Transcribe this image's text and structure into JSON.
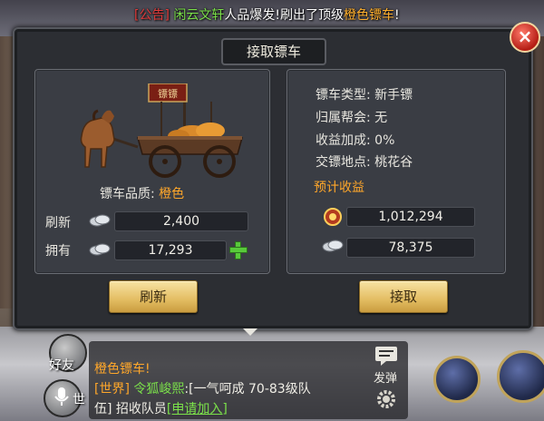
{
  "announcement": {
    "tag": "[公告]",
    "player": "闲云文轩",
    "text1": "人品爆发!刷出了顶级",
    "highlight": "橙色镖车",
    "text2": "!"
  },
  "dialog": {
    "title": "接取镖车",
    "close_symbol": "×"
  },
  "left_panel": {
    "cart_banner": "镖镖",
    "quality_label": "镖车品质:",
    "quality_value": "橙色",
    "refresh_label": "刷新",
    "refresh_cost": "2,400",
    "own_label": "拥有",
    "own_amount": "17,293",
    "refresh_button": "刷新"
  },
  "right_panel": {
    "type_label": "镖车类型:",
    "type_value": "新手镖",
    "guild_label": "归属帮会:",
    "guild_value": "无",
    "bonus_label": "收益加成:",
    "bonus_value": "0%",
    "place_label": "交镖地点:",
    "place_value": "桃花谷",
    "profit_title": "预计收益",
    "reward_exp": "1,012,294",
    "reward_silver": "78,375",
    "accept_button": "接取"
  },
  "chat": {
    "line1": "橙色镖车!",
    "channel": "[世界]",
    "sender": "令狐峻熙",
    "msg1": ":[一气呵成 70-83级队",
    "msg2a": "伍] 招收队员",
    "apply": "[申请加入]",
    "send_label": "发弹"
  },
  "side": {
    "friend": "好友",
    "world": "世"
  },
  "icons": {
    "coin": "silver-coin-icon",
    "plus": "plus-icon",
    "close": "close-icon"
  },
  "colors": {
    "accent_orange": "#ffa72a",
    "accent_green": "#58c93b",
    "announce_red": "#e03b3b"
  }
}
